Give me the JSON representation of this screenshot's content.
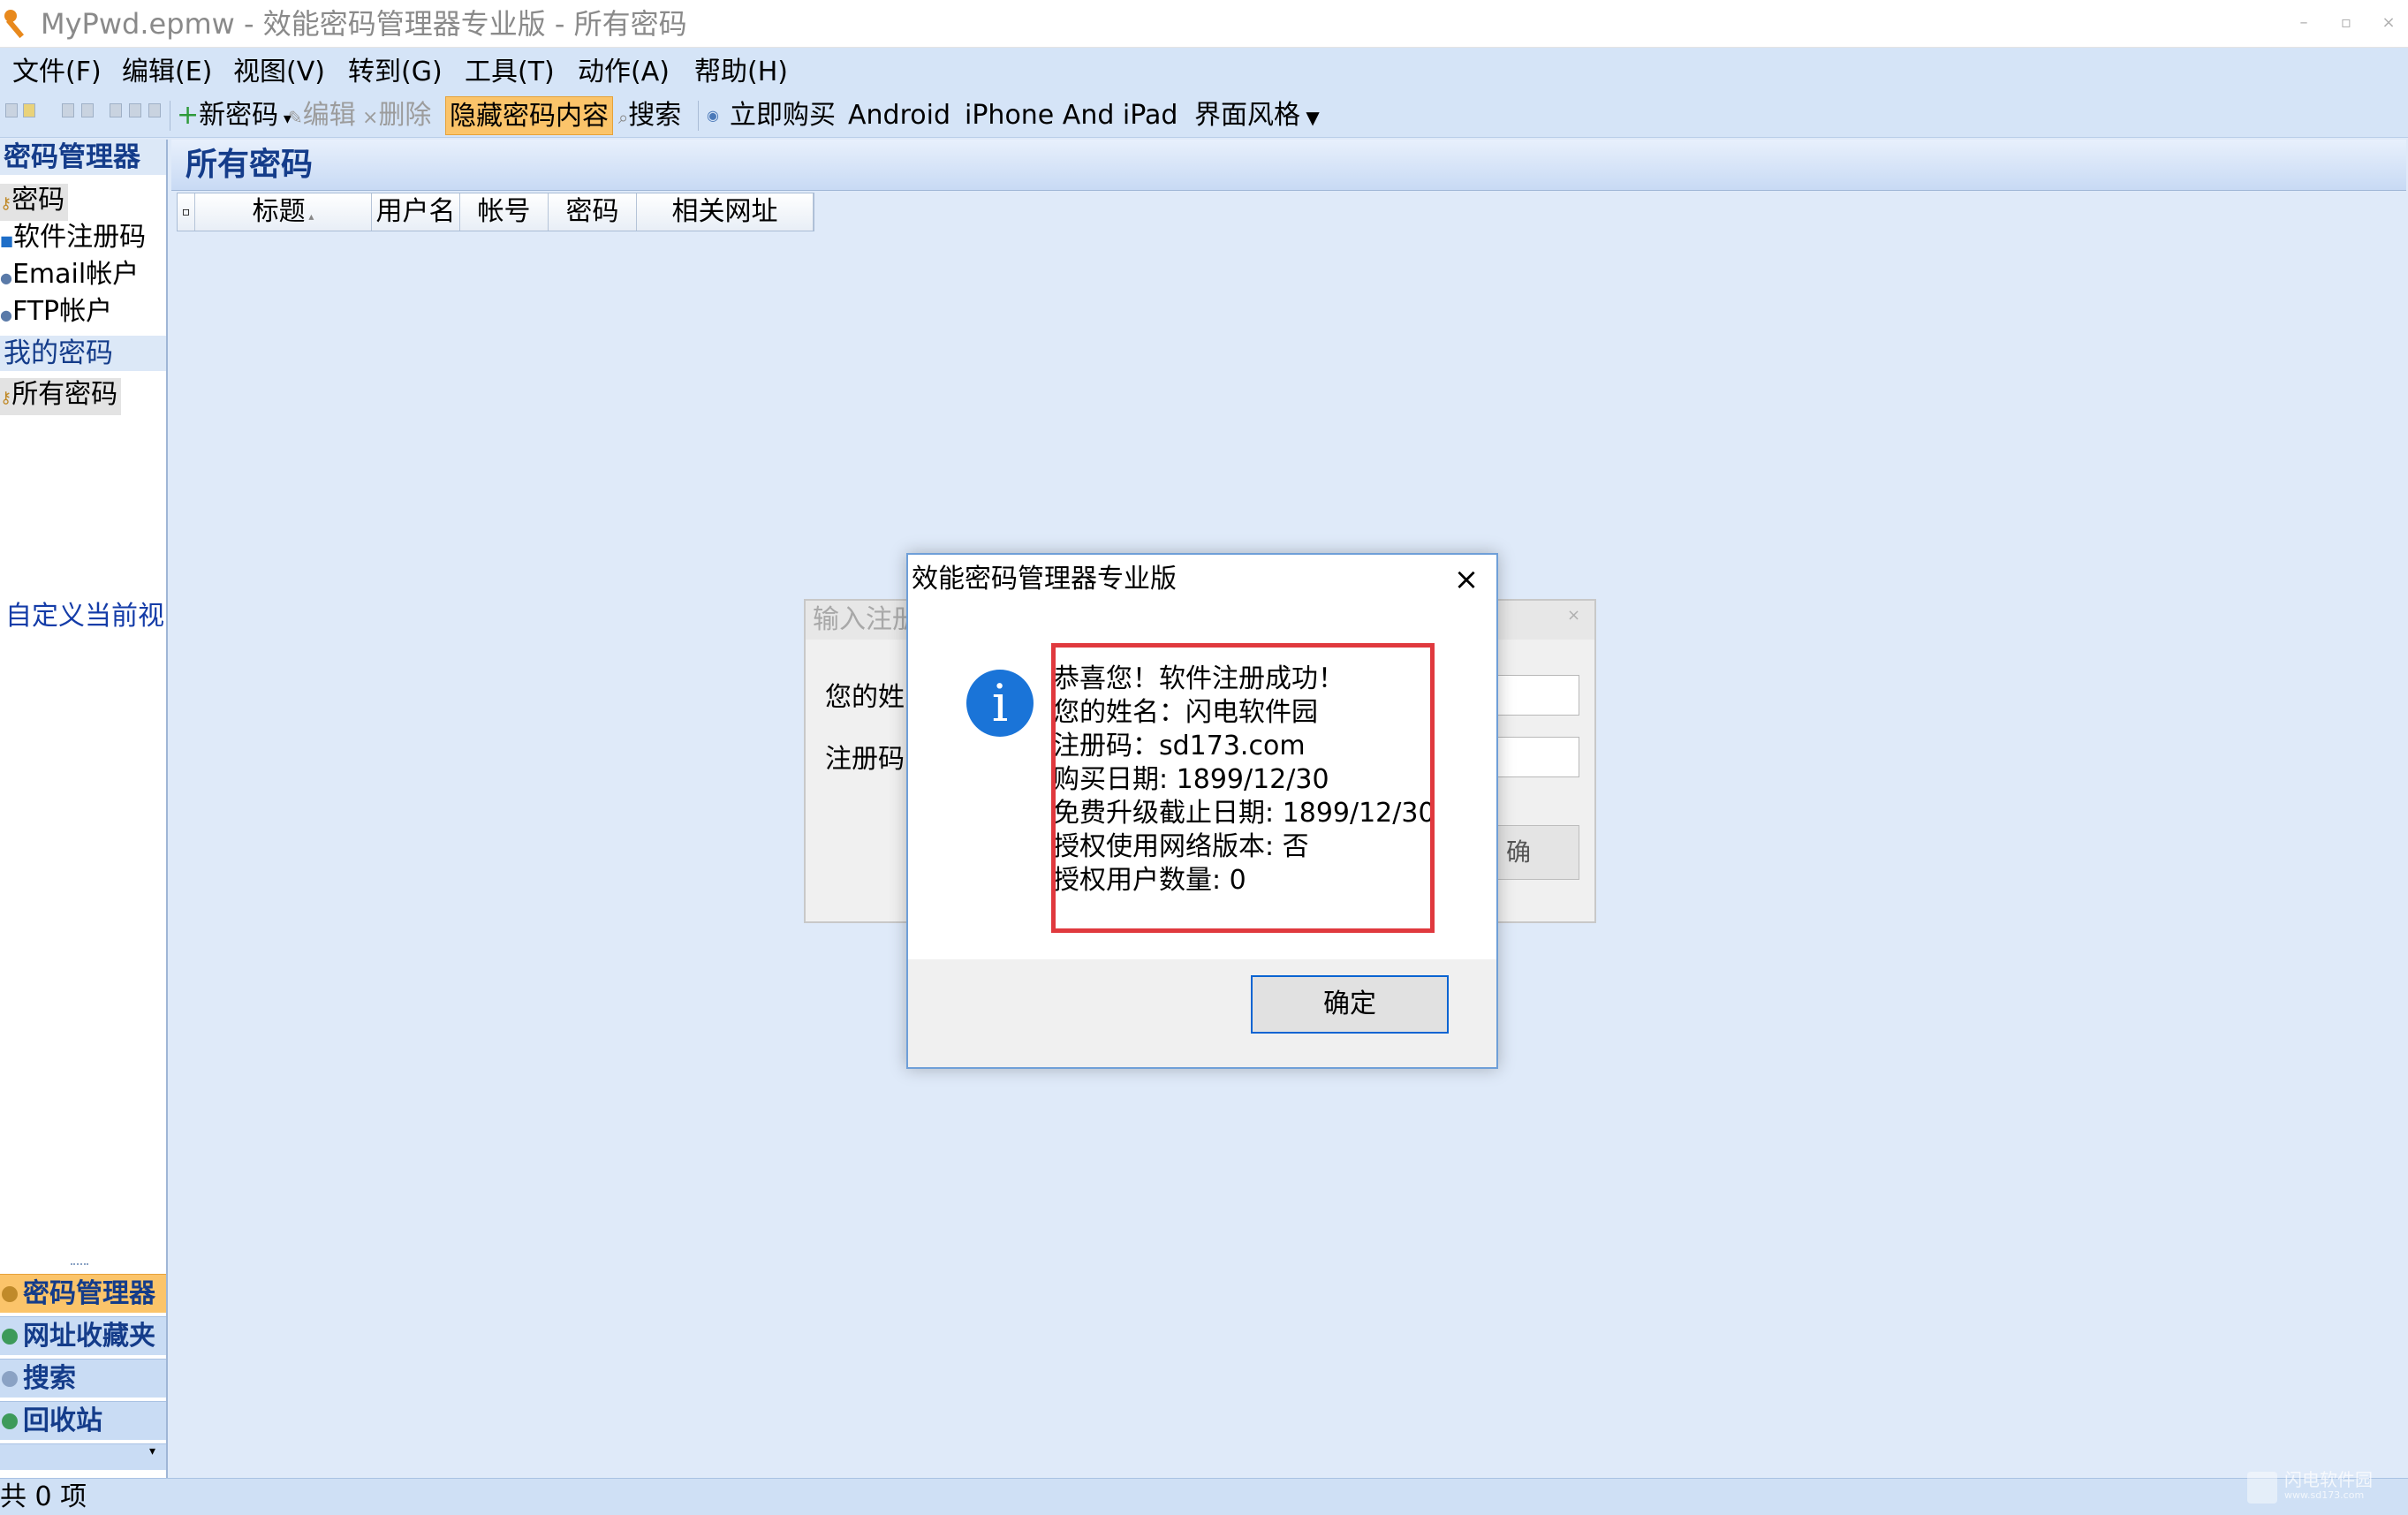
{
  "window": {
    "title": "MyPwd.epmw - 效能密码管理器专业版 - 所有密码",
    "controls": [
      "–",
      "▫",
      "×"
    ]
  },
  "menu": [
    "文件(F)",
    "编辑(E)",
    "视图(V)",
    "转到(G)",
    "工具(T)",
    "动作(A)",
    "帮助(H)"
  ],
  "toolbar": {
    "new": "新密码",
    "edit": "编辑",
    "delete": "删除",
    "hide": "隐藏密码内容",
    "search": "搜索",
    "buy": "立即购买",
    "android": "Android",
    "iphone": "iPhone And iPad",
    "style": "界面风格"
  },
  "sidebar": {
    "section_manager": "密码管理器",
    "categories": [
      "密码",
      "软件注册码",
      "Email帐户",
      "FTP帐户"
    ],
    "section_mine": "我的密码",
    "all": "所有密码",
    "custom": "自定义当前视",
    "bottom": [
      "密码管理器",
      "网址收藏夹",
      "搜索",
      "回收站"
    ]
  },
  "content": {
    "title": "所有密码",
    "columns": [
      "标题",
      "用户名",
      "帐号",
      "密码",
      "相关网址"
    ]
  },
  "status": "共 0 项",
  "background_dialog": {
    "title": "输入注册",
    "name_label": "您的姓",
    "code_label": "注册码",
    "button": "确"
  },
  "message_box": {
    "title": "效能密码管理器专业版",
    "lines": [
      "恭喜您！软件注册成功！",
      "您的姓名：闪电软件园",
      "注册码：sd173.com",
      "购买日期: 1899/12/30",
      "免费升级截止日期: 1899/12/30",
      "授权使用网络版本: 否",
      "授权用户数量: 0"
    ],
    "ok": "确定",
    "icon": "information-icon",
    "close": "×"
  },
  "watermark": {
    "name": "闪电软件园",
    "url": "www.sd173.com"
  },
  "colors": {
    "accent": "#fbc46a",
    "highlight_border": "#e0393e",
    "info_icon": "#1a74d8",
    "link": "#143ca8"
  }
}
